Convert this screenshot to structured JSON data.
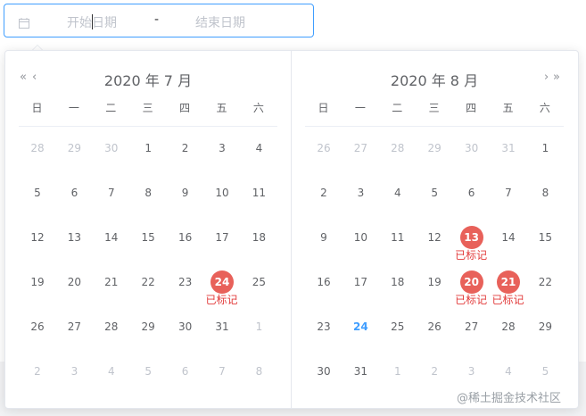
{
  "input": {
    "start_placeholder": "开始日期",
    "separator": "-",
    "end_placeholder": "结束日期",
    "icon": "calendar-icon"
  },
  "weekdays": [
    "日",
    "一",
    "二",
    "三",
    "四",
    "五",
    "六"
  ],
  "mark_label": "已标记",
  "accent_color": "#409eff",
  "mark_color": "#e8615a",
  "left_panel": {
    "title": "2020 年 7 月",
    "nav": [
      "«",
      "‹"
    ],
    "weeks": [
      [
        {
          "d": "28",
          "o": true
        },
        {
          "d": "29",
          "o": true
        },
        {
          "d": "30",
          "o": true
        },
        {
          "d": "1"
        },
        {
          "d": "2"
        },
        {
          "d": "3"
        },
        {
          "d": "4"
        }
      ],
      [
        {
          "d": "5"
        },
        {
          "d": "6"
        },
        {
          "d": "7"
        },
        {
          "d": "8"
        },
        {
          "d": "9"
        },
        {
          "d": "10"
        },
        {
          "d": "11"
        }
      ],
      [
        {
          "d": "12"
        },
        {
          "d": "13"
        },
        {
          "d": "14"
        },
        {
          "d": "15"
        },
        {
          "d": "16"
        },
        {
          "d": "17"
        },
        {
          "d": "18"
        }
      ],
      [
        {
          "d": "19"
        },
        {
          "d": "20"
        },
        {
          "d": "21"
        },
        {
          "d": "22"
        },
        {
          "d": "23"
        },
        {
          "d": "24",
          "m": true
        },
        {
          "d": "25"
        }
      ],
      [
        {
          "d": "26"
        },
        {
          "d": "27"
        },
        {
          "d": "28"
        },
        {
          "d": "29"
        },
        {
          "d": "30"
        },
        {
          "d": "31"
        },
        {
          "d": "1",
          "o": true
        }
      ],
      [
        {
          "d": "2",
          "o": true
        },
        {
          "d": "3",
          "o": true
        },
        {
          "d": "4",
          "o": true
        },
        {
          "d": "5",
          "o": true
        },
        {
          "d": "6",
          "o": true
        },
        {
          "d": "7",
          "o": true
        },
        {
          "d": "8",
          "o": true
        }
      ]
    ]
  },
  "right_panel": {
    "title": "2020 年 8 月",
    "nav": [
      "›",
      "»"
    ],
    "weeks": [
      [
        {
          "d": "26",
          "o": true
        },
        {
          "d": "27",
          "o": true
        },
        {
          "d": "28",
          "o": true
        },
        {
          "d": "29",
          "o": true
        },
        {
          "d": "30",
          "o": true
        },
        {
          "d": "31",
          "o": true
        },
        {
          "d": "1"
        }
      ],
      [
        {
          "d": "2"
        },
        {
          "d": "3"
        },
        {
          "d": "4"
        },
        {
          "d": "5"
        },
        {
          "d": "6"
        },
        {
          "d": "7"
        },
        {
          "d": "8"
        }
      ],
      [
        {
          "d": "9"
        },
        {
          "d": "10"
        },
        {
          "d": "11"
        },
        {
          "d": "12"
        },
        {
          "d": "13",
          "m": true
        },
        {
          "d": "14"
        },
        {
          "d": "15"
        }
      ],
      [
        {
          "d": "16"
        },
        {
          "d": "17"
        },
        {
          "d": "18"
        },
        {
          "d": "19"
        },
        {
          "d": "20",
          "m": true
        },
        {
          "d": "21",
          "m": true
        },
        {
          "d": "22"
        }
      ],
      [
        {
          "d": "23"
        },
        {
          "d": "24",
          "t": true
        },
        {
          "d": "25"
        },
        {
          "d": "26"
        },
        {
          "d": "27"
        },
        {
          "d": "28"
        },
        {
          "d": "29"
        }
      ],
      [
        {
          "d": "30"
        },
        {
          "d": "31"
        },
        {
          "d": "1",
          "o": true
        },
        {
          "d": "2",
          "o": true
        },
        {
          "d": "3",
          "o": true
        },
        {
          "d": "4",
          "o": true
        },
        {
          "d": "5",
          "o": true
        }
      ]
    ]
  },
  "watermark": "@稀土掘金技术社区"
}
